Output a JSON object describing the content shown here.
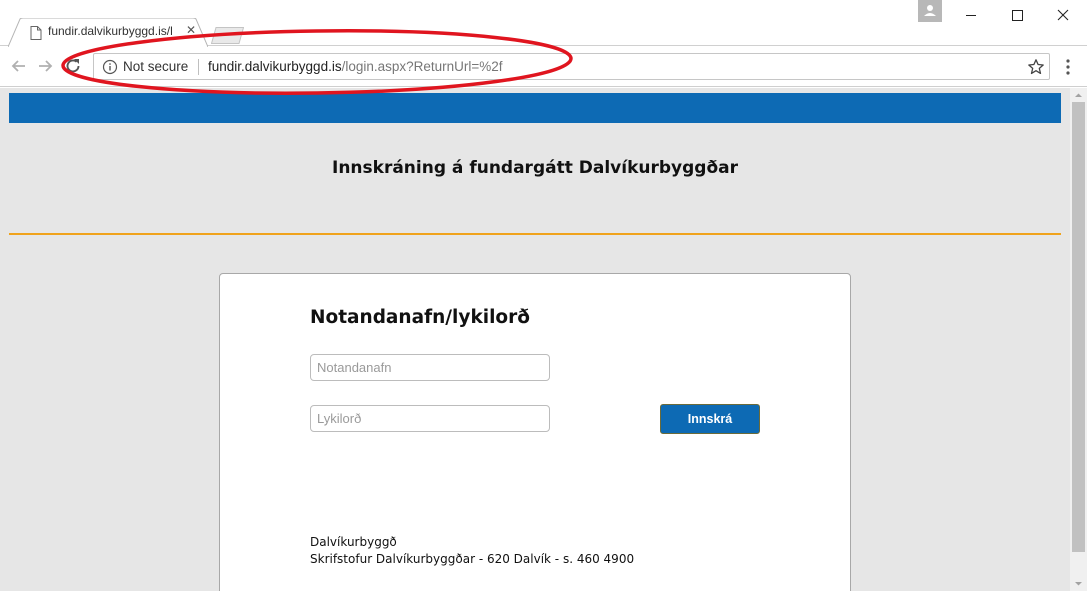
{
  "browser": {
    "tab": {
      "title": "fundir.dalvikurbyggd.is/l",
      "favicon": "page-icon",
      "close_glyph": "✕"
    },
    "address_bar": {
      "security_label": "Not secure",
      "url_host": "fundir.dalvikurbyggd.is",
      "url_path": "/login.aspx?ReturnUrl=%2f"
    },
    "icons": {
      "back": "arrow-left-icon",
      "forward": "arrow-right-icon",
      "reload": "reload-icon",
      "info": "info-icon",
      "bookmark": "star-icon",
      "menu": "three-dot-menu-icon",
      "profile": "person-icon"
    },
    "annotation_color": "#e0151f"
  },
  "page": {
    "colors": {
      "brand_blue": "#0d6ab4",
      "accent_orange": "#f0a31c",
      "background": "#e6e6e6"
    },
    "title": "Innskráning á fundargátt Dalvíkurbyggðar",
    "login": {
      "heading": "Notandanafn/lykilorð",
      "username": {
        "value": "",
        "placeholder": "Notandanafn"
      },
      "password": {
        "value": "",
        "placeholder": "Lykilorð"
      },
      "submit_label": "Innskrá"
    },
    "footer": {
      "organization": "Dalvíkurbyggð",
      "address": "Skrifstofur Dalvíkurbyggðar - 620 Dalvík - s. 460 4900"
    }
  }
}
